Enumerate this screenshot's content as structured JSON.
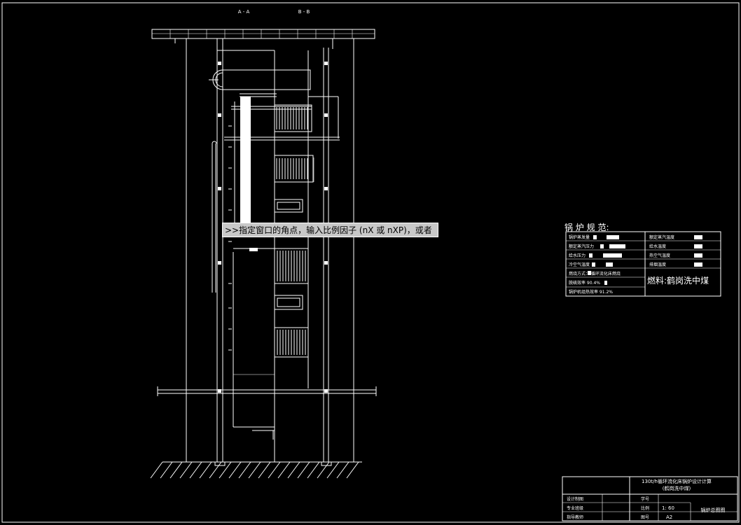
{
  "section_labels": [
    "A - A",
    "B - B"
  ],
  "command_prompt": ">>指定窗口的角点，输入比例因子 (nX 或 nXP)，或者",
  "spec": {
    "title": "锅 炉 规 范:",
    "rows": [
      {
        "left": "锅炉蒸发量",
        "right": "额定蒸汽温度"
      },
      {
        "left": "额定蒸汽压力",
        "right": "给水温度"
      },
      {
        "left": "给水压力",
        "right": "热空气温度"
      },
      {
        "left": "冷空气温度",
        "right": "排烟温度"
      }
    ],
    "fuel_method": "燃烧方式： 循环流化床燃烧",
    "efficiency_1": "脱硫效率    90.4%",
    "efficiency_2": "锅炉机组热效率  91.2%",
    "fuel": "燃料:鹤岗洗中煤"
  },
  "title_block": {
    "title_line1": "130t/h循环流化床锅炉设计计算",
    "title_line2": "(鹤岗洗中煤)",
    "rows": [
      {
        "label": "设计制图",
        "field": "学号"
      },
      {
        "label": "专业班级",
        "field": "比例",
        "value": "1: 60"
      },
      {
        "label": "指导教师",
        "field": "图号",
        "value": "A2"
      }
    ],
    "drawing_name": "锅炉总图图"
  }
}
